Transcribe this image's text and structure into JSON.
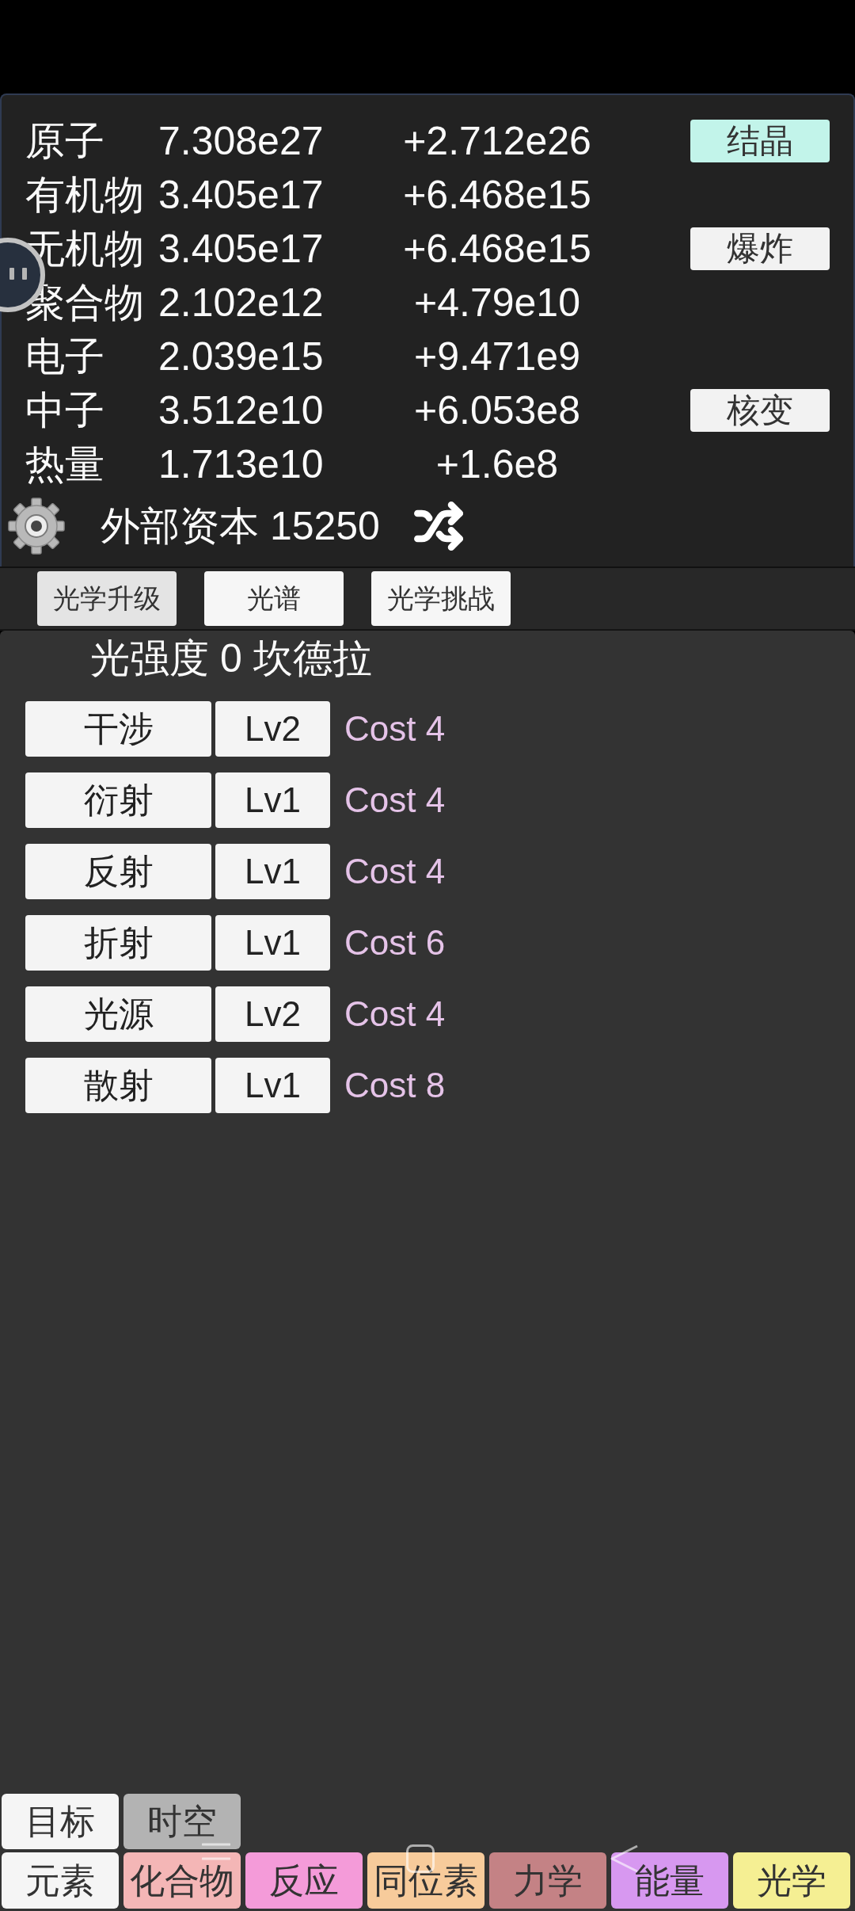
{
  "resources": [
    {
      "name": "原子",
      "amount": "7.308e27",
      "rate": "+2.712e26",
      "action": {
        "label": "结晶",
        "active": true
      }
    },
    {
      "name": "有机物",
      "amount": "3.405e17",
      "rate": "+6.468e15"
    },
    {
      "name": "无机物",
      "amount": "3.405e17",
      "rate": "+6.468e15",
      "action": {
        "label": "爆炸",
        "active": false
      }
    },
    {
      "name": "聚合物",
      "amount": "2.102e12",
      "rate": "+4.79e10"
    },
    {
      "name": "电子",
      "amount": "2.039e15",
      "rate": "+9.471e9"
    },
    {
      "name": "中子",
      "amount": "3.512e10",
      "rate": "+6.053e8",
      "action": {
        "label": "核变",
        "active": false
      }
    },
    {
      "name": "热量",
      "amount": "1.713e10",
      "rate": "+1.6e8"
    }
  ],
  "capital": "外部资本 15250",
  "sub_tabs": [
    {
      "label": "光学升级",
      "selected": true
    },
    {
      "label": "光谱",
      "selected": false
    },
    {
      "label": "光学挑战",
      "selected": false
    }
  ],
  "intensity": "光强度 0 坎德拉",
  "upgrades": [
    {
      "name": "干涉",
      "level": "Lv2",
      "cost": "Cost 4"
    },
    {
      "name": "衍射",
      "level": "Lv1",
      "cost": "Cost 4"
    },
    {
      "name": "反射",
      "level": "Lv1",
      "cost": "Cost 4"
    },
    {
      "name": "折射",
      "level": "Lv1",
      "cost": "Cost 6"
    },
    {
      "name": "光源",
      "level": "Lv2",
      "cost": "Cost 4"
    },
    {
      "name": "散射",
      "level": "Lv1",
      "cost": "Cost 8"
    }
  ],
  "side_tabs": [
    {
      "label": "目标",
      "disabled": false
    },
    {
      "label": "时空",
      "disabled": true
    }
  ],
  "nav_tabs": [
    {
      "label": "元素",
      "color": "#f5f5f5"
    },
    {
      "label": "化合物",
      "color": "#f4b6b6"
    },
    {
      "label": "反应",
      "color": "#f49bd9"
    },
    {
      "label": "同位素",
      "color": "#f7cb9b"
    },
    {
      "label": "力学",
      "color": "#c48285"
    },
    {
      "label": "能量",
      "color": "#d798f0"
    },
    {
      "label": "光学",
      "color": "#f5ef93"
    }
  ]
}
